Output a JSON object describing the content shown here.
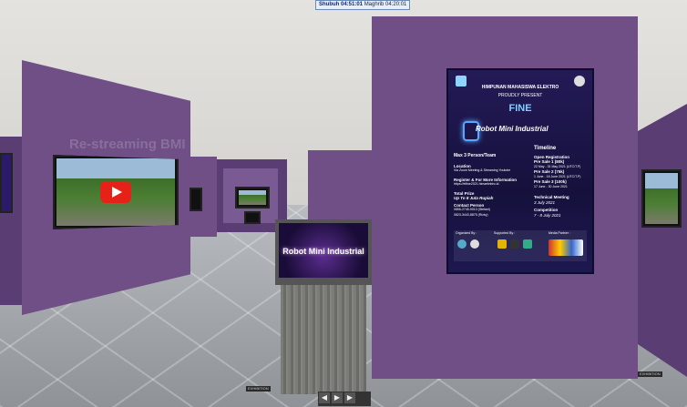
{
  "timer": {
    "left_label": "Shubuh 04:51:01",
    "right_label": "Maghrib 04:20:01"
  },
  "left_hall": {
    "wall_title": "Re-streaming BMI"
  },
  "kiosk": {
    "display_text": "Robot Mini Industrial"
  },
  "poster": {
    "org_line": "HIMPUNAN MAHASISWA ELEKTRO",
    "present_line": "PROUDLY PRESENT",
    "event_logo": "FINE",
    "title": "Robot Mini Industrial",
    "left": {
      "team": "Max 3 Person/Team",
      "location_label": "Location",
      "location_value": "Via Zoom Meeting & Streaming Youtube",
      "register": "Register & For More Information",
      "register_url": "https://elfine2021.himaelektro.id",
      "prize_label": "Total Prize",
      "prize_value": "Up To 8 Juta Rupiah",
      "contact_label": "Contact Person",
      "contact1": "0856-2745-9010 (Stefani)",
      "contact2": "0823-3443-8875 (Rizky)",
      "organized_label": "Organized By :",
      "supported_label": "Supported By :",
      "media_label": "Media Partner :"
    },
    "right": {
      "timeline_label": "Timeline",
      "open_reg": "Open Registration",
      "ps1": "Pre Sale 1 (80k)",
      "ps1_date": "22 May - 31 May 2021 (UTC/T.P)",
      "ps2": "Pre Sale 2 (75k)",
      "ps2_date": "1 June - 16 June 2021 (UTC/T.P)",
      "ps3": "Pre Sale 3 (100k)",
      "ps3_date": "17 June - 30 June 2021",
      "tech_label": "Technical Meeting",
      "tech_date": "3 July 2021",
      "comp_label": "Competition",
      "comp_date": "7 - 8 July 2021"
    }
  },
  "media_controls": {
    "prev": "◀",
    "play": "▶",
    "next": "▶"
  },
  "floor_signs": {
    "center": "EXHIBITION",
    "right": "EXHIBITION"
  }
}
